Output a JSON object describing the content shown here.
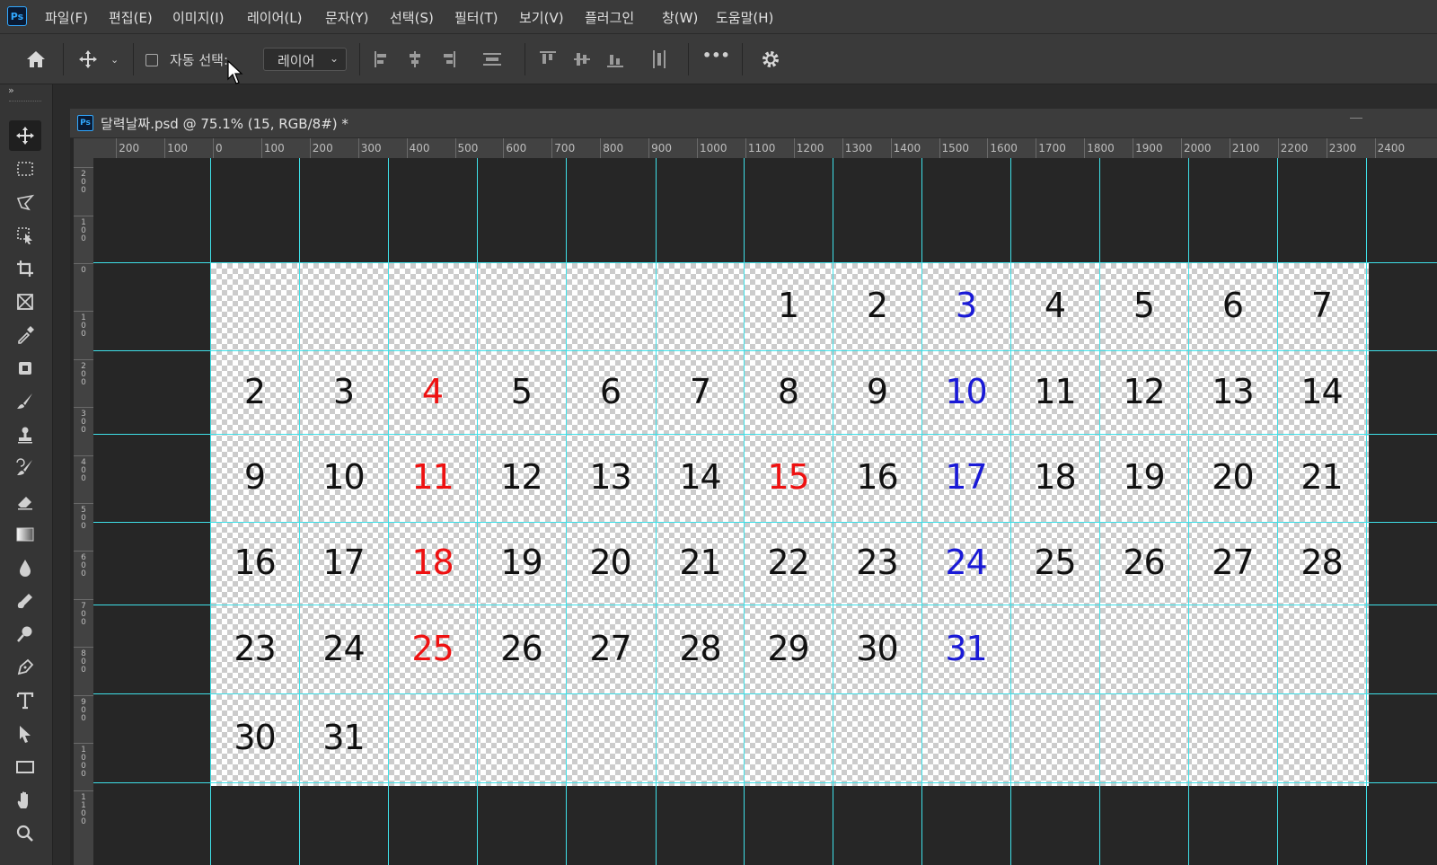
{
  "app": {
    "logo": "Ps"
  },
  "menu": [
    "파일(F)",
    "편집(E)",
    "이미지(I)",
    "레이어(L)",
    "문자(Y)",
    "선택(S)",
    "필터(T)",
    "보기(V)",
    "플러그인",
    "창(W)",
    "도움말(H)"
  ],
  "options": {
    "auto_select_label": "자동 선택:",
    "auto_select_checked": false,
    "layer_select_value": "레이어",
    "more_label": "•••"
  },
  "document": {
    "title": "달력날짜.psd @ 75.1% (15, RGB/8#) *",
    "ps_icon": "Ps"
  },
  "rulers": {
    "horizontal": [
      "200",
      "100",
      "0",
      "100",
      "200",
      "300",
      "400",
      "500",
      "600",
      "700",
      "800",
      "900",
      "1000",
      "1100",
      "1200",
      "1300",
      "1400",
      "1500",
      "1600",
      "1700",
      "1800",
      "1900",
      "2000",
      "2100",
      "2200",
      "2300",
      "2400"
    ],
    "vertical": [
      "200",
      "100",
      "0",
      "100",
      "200",
      "300",
      "400",
      "500",
      "600",
      "700",
      "800",
      "900",
      "1000",
      "1100"
    ]
  },
  "calendar": {
    "rows": [
      [
        {
          "t": "",
          "c": ""
        },
        {
          "t": "",
          "c": ""
        },
        {
          "t": "",
          "c": ""
        },
        {
          "t": "",
          "c": ""
        },
        {
          "t": "",
          "c": ""
        },
        {
          "t": "",
          "c": ""
        },
        {
          "t": "1",
          "c": ""
        },
        {
          "t": "2",
          "c": ""
        },
        {
          "t": "3",
          "c": "blue"
        },
        {
          "t": "4",
          "c": ""
        },
        {
          "t": "5",
          "c": ""
        },
        {
          "t": "6",
          "c": ""
        },
        {
          "t": "7",
          "c": ""
        }
      ],
      [
        {
          "t": "2",
          "c": ""
        },
        {
          "t": "3",
          "c": ""
        },
        {
          "t": "4",
          "c": "red"
        },
        {
          "t": "5",
          "c": ""
        },
        {
          "t": "6",
          "c": ""
        },
        {
          "t": "7",
          "c": ""
        },
        {
          "t": "8",
          "c": ""
        },
        {
          "t": "9",
          "c": ""
        },
        {
          "t": "10",
          "c": "blue"
        },
        {
          "t": "11",
          "c": ""
        },
        {
          "t": "12",
          "c": ""
        },
        {
          "t": "13",
          "c": ""
        },
        {
          "t": "14",
          "c": ""
        }
      ],
      [
        {
          "t": "9",
          "c": ""
        },
        {
          "t": "10",
          "c": ""
        },
        {
          "t": "11",
          "c": "red"
        },
        {
          "t": "12",
          "c": ""
        },
        {
          "t": "13",
          "c": ""
        },
        {
          "t": "14",
          "c": ""
        },
        {
          "t": "15",
          "c": "red"
        },
        {
          "t": "16",
          "c": ""
        },
        {
          "t": "17",
          "c": "blue"
        },
        {
          "t": "18",
          "c": ""
        },
        {
          "t": "19",
          "c": ""
        },
        {
          "t": "20",
          "c": ""
        },
        {
          "t": "21",
          "c": ""
        }
      ],
      [
        {
          "t": "16",
          "c": ""
        },
        {
          "t": "17",
          "c": ""
        },
        {
          "t": "18",
          "c": "red"
        },
        {
          "t": "19",
          "c": ""
        },
        {
          "t": "20",
          "c": ""
        },
        {
          "t": "21",
          "c": ""
        },
        {
          "t": "22",
          "c": ""
        },
        {
          "t": "23",
          "c": ""
        },
        {
          "t": "24",
          "c": "blue"
        },
        {
          "t": "25",
          "c": ""
        },
        {
          "t": "26",
          "c": ""
        },
        {
          "t": "27",
          "c": ""
        },
        {
          "t": "28",
          "c": ""
        }
      ],
      [
        {
          "t": "23",
          "c": ""
        },
        {
          "t": "24",
          "c": ""
        },
        {
          "t": "25",
          "c": "red"
        },
        {
          "t": "26",
          "c": ""
        },
        {
          "t": "27",
          "c": ""
        },
        {
          "t": "28",
          "c": ""
        },
        {
          "t": "29",
          "c": ""
        },
        {
          "t": "30",
          "c": ""
        },
        {
          "t": "31",
          "c": "blue"
        },
        {
          "t": "",
          "c": ""
        },
        {
          "t": "",
          "c": ""
        },
        {
          "t": "",
          "c": ""
        },
        {
          "t": "",
          "c": ""
        }
      ],
      [
        {
          "t": "30",
          "c": ""
        },
        {
          "t": "31",
          "c": ""
        },
        {
          "t": "",
          "c": ""
        },
        {
          "t": "",
          "c": ""
        },
        {
          "t": "",
          "c": ""
        },
        {
          "t": "",
          "c": ""
        },
        {
          "t": "",
          "c": ""
        },
        {
          "t": "",
          "c": ""
        },
        {
          "t": "",
          "c": ""
        },
        {
          "t": "",
          "c": ""
        },
        {
          "t": "",
          "c": ""
        },
        {
          "t": "",
          "c": ""
        },
        {
          "t": "",
          "c": ""
        }
      ]
    ]
  },
  "colors": {
    "guide": "#3fe0e8",
    "holiday": "#ee1111",
    "saturday": "#1a1ad6",
    "accent": "#31a8ff"
  },
  "tools": [
    "move-tool-icon",
    "marquee-tool-icon",
    "lasso-tool-icon",
    "object-select-tool-icon",
    "crop-tool-icon",
    "frame-tool-icon",
    "eyedropper-tool-icon",
    "healing-brush-icon",
    "brush-tool-icon",
    "clone-stamp-icon",
    "history-brush-icon",
    "eraser-tool-icon",
    "gradient-tool-icon",
    "blur-tool-icon",
    "dodge-tool-icon",
    "sponge-tool-icon",
    "pen-tool-icon",
    "type-tool-icon",
    "path-select-icon",
    "rectangle-tool-icon",
    "hand-tool-icon",
    "zoom-tool-icon"
  ]
}
